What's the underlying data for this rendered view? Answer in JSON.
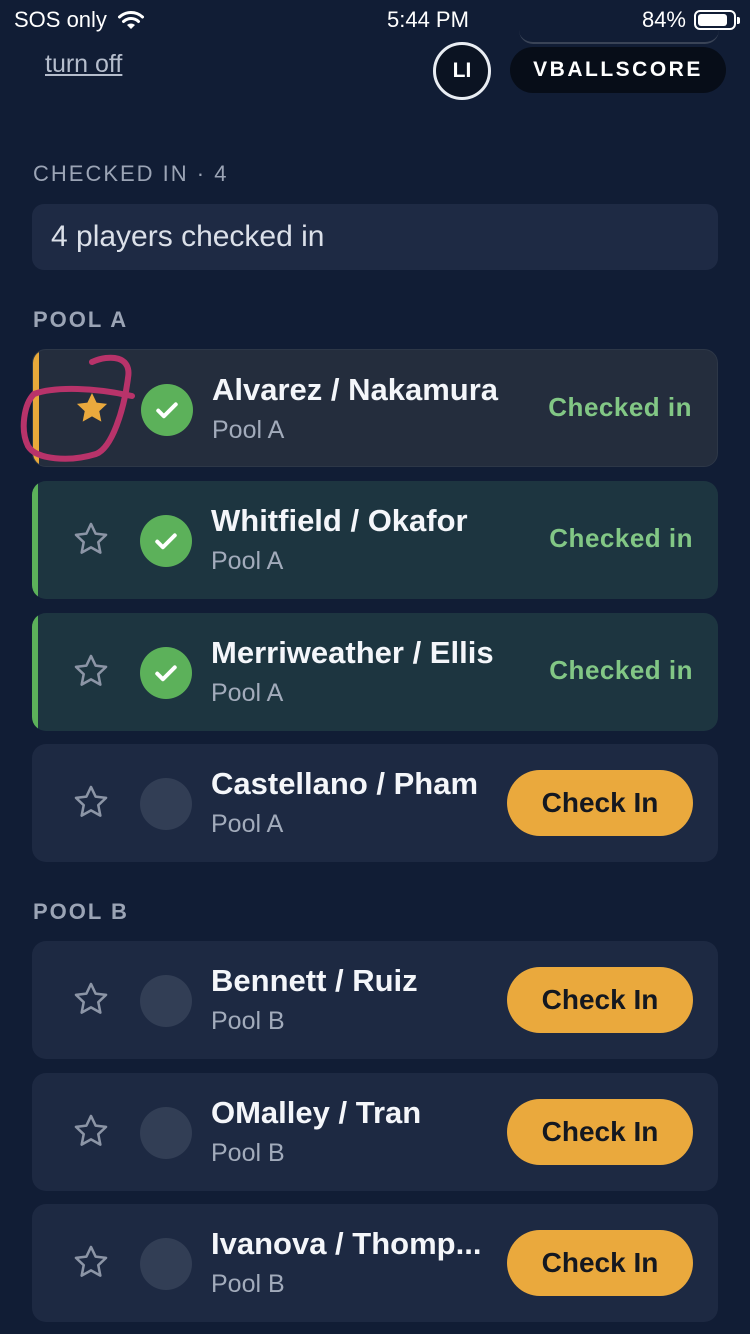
{
  "status_bar": {
    "carrier": "SOS only",
    "time": "5:44 PM",
    "battery": "84%",
    "battery_level": 0.84
  },
  "header": {
    "turn_off": "turn off",
    "avatar_initials": "LI",
    "brand": "VBALLSCORE"
  },
  "checked_in": {
    "label": "CHECKED IN · 4",
    "summary": "4 players checked in"
  },
  "colors": {
    "accent": "#eaa93d",
    "success": "#5cb15a",
    "success_text": "#82c785",
    "background": "#111d35",
    "card": "#1d2942",
    "annotation": "#b8336a"
  },
  "pools": [
    {
      "label": "POOL A",
      "teams": [
        {
          "names": "Alvarez / Nakamura",
          "pool": "Pool A",
          "starred": true,
          "checked_in": true,
          "status": "Checked in"
        },
        {
          "names": "Whitfield / Okafor",
          "pool": "Pool A",
          "starred": false,
          "checked_in": true,
          "status": "Checked in"
        },
        {
          "names": "Merriweather / Ellis",
          "pool": "Pool A",
          "starred": false,
          "checked_in": true,
          "status": "Checked in"
        },
        {
          "names": "Castellano / Pham",
          "pool": "Pool A",
          "starred": false,
          "checked_in": false,
          "action": "Check In"
        }
      ]
    },
    {
      "label": "POOL B",
      "teams": [
        {
          "names": "Bennett / Ruiz",
          "pool": "Pool B",
          "starred": false,
          "checked_in": false,
          "action": "Check In"
        },
        {
          "names": "OMalley / Tran",
          "pool": "Pool B",
          "starred": false,
          "checked_in": false,
          "action": "Check In"
        },
        {
          "names": "Ivanova / Thomp...",
          "pool": "Pool B",
          "starred": false,
          "checked_in": false,
          "action": "Check In"
        }
      ]
    }
  ]
}
